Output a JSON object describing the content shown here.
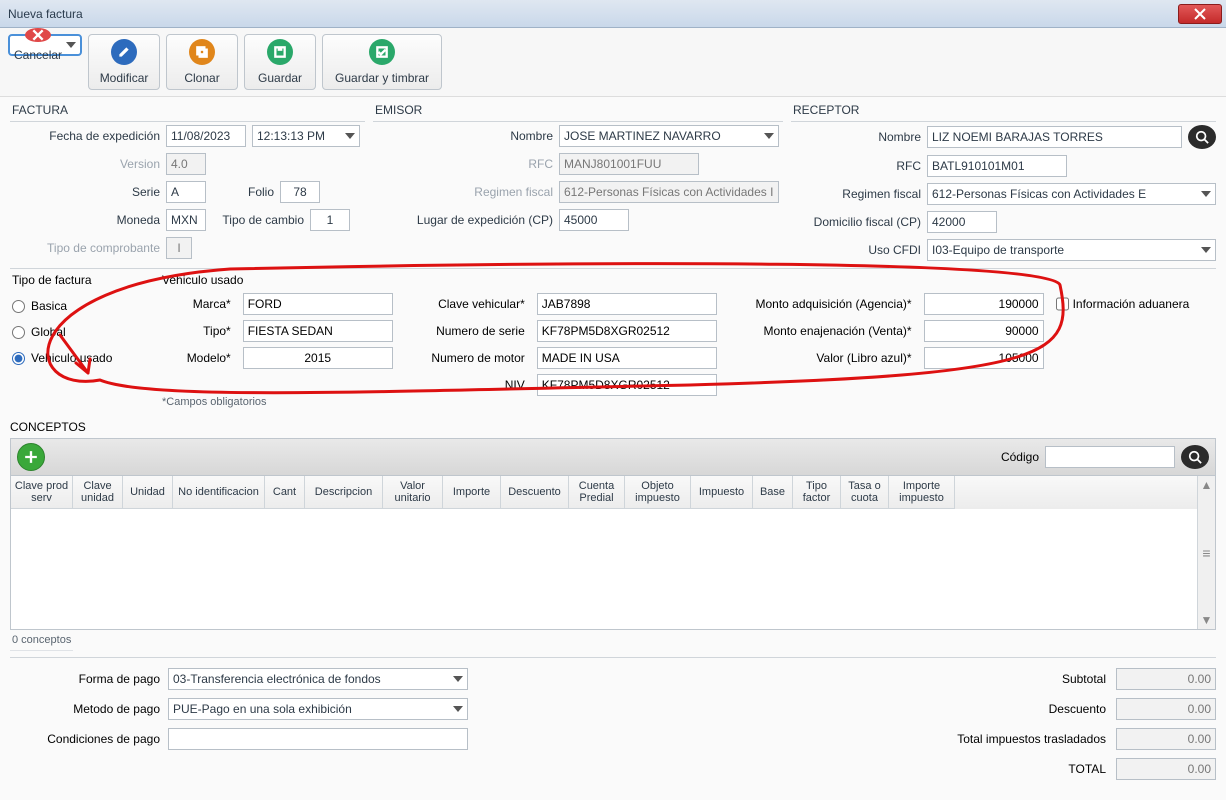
{
  "window": {
    "title": "Nueva factura"
  },
  "toolbar": {
    "cancel": "Cancelar",
    "modify": "Modificar",
    "clone": "Clonar",
    "save": "Guardar",
    "stamp": "Guardar y timbrar"
  },
  "sections": {
    "factura": "FACTURA",
    "emisor": "EMISOR",
    "receptor": "RECEPTOR"
  },
  "factura": {
    "fecha_lbl": "Fecha de expedición",
    "fecha_date": "11/08/2023",
    "fecha_time": "12:13:13  PM",
    "version_lbl": "Version",
    "version": "4.0",
    "serie_lbl": "Serie",
    "serie": "A",
    "folio_lbl": "Folio",
    "folio": "78",
    "moneda_lbl": "Moneda",
    "moneda": "MXN",
    "tc_lbl": "Tipo de cambio",
    "tc": "1",
    "tipocomp_lbl": "Tipo de comprobante",
    "tipocomp": "I"
  },
  "emisor": {
    "nombre_lbl": "Nombre",
    "nombre": "JOSE MARTINEZ NAVARRO",
    "rfc_lbl": "RFC",
    "rfc": "MANJ801001FUU",
    "regimen_lbl": "Regimen fiscal",
    "regimen": "612-Personas Físicas con Actividades I",
    "lugar_lbl": "Lugar de expedición (CP)",
    "lugar": "45000"
  },
  "receptor": {
    "nombre_lbl": "Nombre",
    "nombre": "LIZ NOEMI BARAJAS TORRES",
    "rfc_lbl": "RFC",
    "rfc": "BATL910101M01",
    "regimen_lbl": "Regimen fiscal",
    "regimen": "612-Personas Físicas con Actividades E",
    "dom_lbl": "Domicilio fiscal (CP)",
    "dom": "42000",
    "uso_lbl": "Uso CFDI",
    "uso": "I03-Equipo de transporte"
  },
  "tipo_factura": {
    "head": "Tipo de factura",
    "basica": "Basica",
    "global": "Global",
    "vehiculo": "Vehiculo usado"
  },
  "vehiculo": {
    "head": "Vehiculo usado",
    "marca_lbl": "Marca*",
    "marca": "FORD",
    "tipo_lbl": "Tipo*",
    "tipo": "FIESTA SEDAN",
    "modelo_lbl": "Modelo*",
    "modelo": "2015",
    "clave_lbl": "Clave vehicular*",
    "clave": "JAB7898",
    "numserie_lbl": "Numero de serie",
    "numserie": "KF78PM5D8XGR02512",
    "nummotor_lbl": "Numero de motor",
    "nummotor": "MADE IN USA",
    "niv_lbl": "NIV",
    "niv": "KF78PM5D8XGR02512",
    "adq_lbl": "Monto adquisición (Agencia)*",
    "adq": "190000",
    "enaj_lbl": "Monto enajenación (Venta)*",
    "enaj": "90000",
    "valor_lbl": "Valor (Libro azul)*",
    "valor": "105000",
    "adu_lbl": "Información aduanera",
    "oblig": "*Campos obligatorios"
  },
  "conceptos": {
    "head": "CONCEPTOS",
    "codigo_lbl": "Código",
    "count": "0 conceptos",
    "cols": [
      "Clave prod serv",
      "Clave unidad",
      "Unidad",
      "No identificacion",
      "Cant",
      "Descripcion",
      "Valor unitario",
      "Importe",
      "Descuento",
      "Cuenta Predial",
      "Objeto impuesto",
      "Impuesto",
      "Base",
      "Tipo factor",
      "Tasa o cuota",
      "Importe impuesto"
    ]
  },
  "pago": {
    "forma_lbl": "Forma de pago",
    "forma": "03-Transferencia electrónica de fondos",
    "metodo_lbl": "Metodo de pago",
    "metodo": "PUE-Pago en una sola exhibición",
    "cond_lbl": "Condiciones de pago",
    "cond": ""
  },
  "totals": {
    "subtotal_lbl": "Subtotal",
    "subtotal": "0.00",
    "descuento_lbl": "Descuento",
    "descuento": "0.00",
    "trasl_lbl": "Total impuestos trasladados",
    "trasl": "0.00",
    "total_lbl": "TOTAL",
    "total": "0.00"
  }
}
